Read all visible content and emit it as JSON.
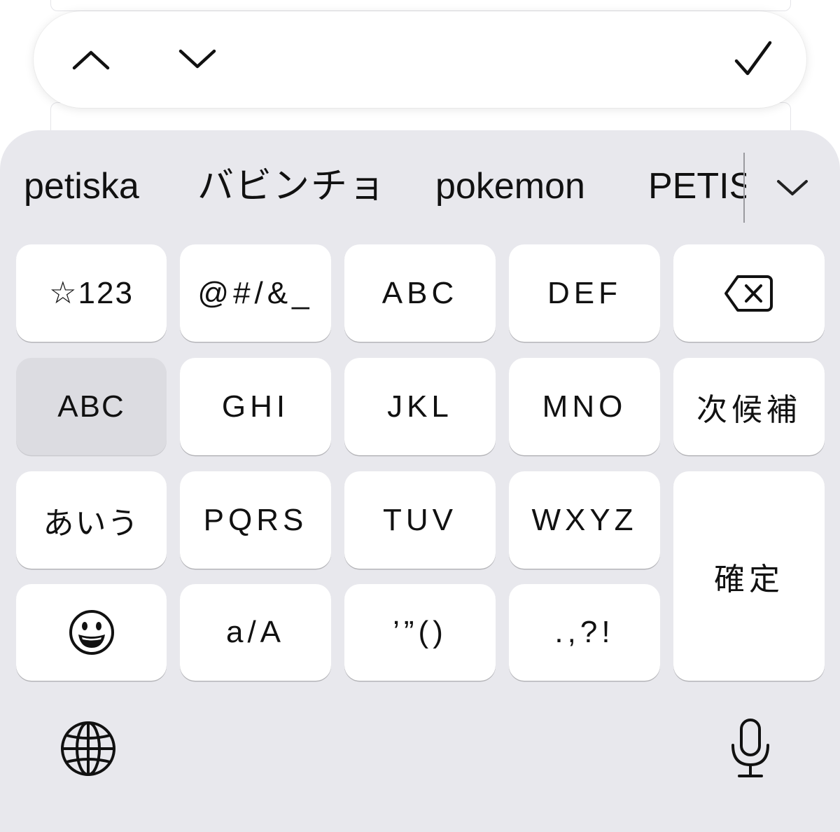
{
  "toolbar": {
    "up_icon": "chevron-up-icon",
    "down_icon": "chevron-down-icon",
    "done_icon": "checkmark-icon"
  },
  "candidates": {
    "items": [
      "petiska",
      "バビンチョ",
      "pokemon",
      "PETISKA"
    ],
    "expand_icon": "chevron-down-icon"
  },
  "keys": {
    "row1": [
      "☆123",
      "@#/&_",
      "ABC",
      "DEF"
    ],
    "delete_icon": "delete-backward-icon",
    "row2": [
      "ABC",
      "GHI",
      "JKL",
      "MNO",
      "次候補"
    ],
    "row3": [
      "あいう",
      "PQRS",
      "TUV",
      "WXYZ"
    ],
    "confirm": "確定",
    "row4": [
      "a/A",
      "’”()",
      ".,?!"
    ],
    "emoji_icon": "emoji-face-icon"
  },
  "bottom": {
    "globe_icon": "globe-icon",
    "mic_icon": "microphone-icon"
  },
  "colors": {
    "keyboard_bg": "#e8e8ed",
    "key_bg": "#ffffff",
    "dark_key_bg": "#dcdce1"
  }
}
